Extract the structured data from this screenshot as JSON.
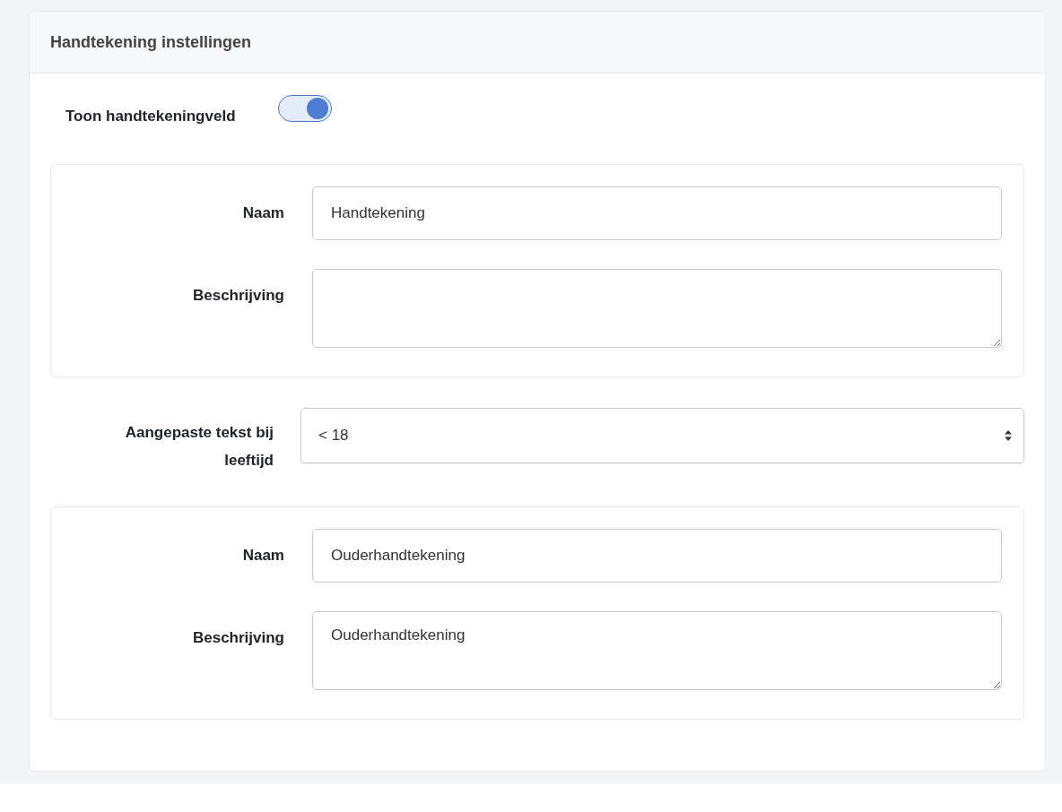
{
  "header": {
    "title": "Handtekening instellingen"
  },
  "toggle": {
    "label": "Toon handtekeningveld",
    "on": true
  },
  "signature": {
    "fields": [
      {
        "label": "Naam",
        "kind": "input",
        "value": "Handtekening"
      },
      {
        "label": "Beschrijving",
        "kind": "textarea"
      }
    ]
  },
  "age_select": {
    "label": "Aangepaste tekst bij leeftijd",
    "value": "< 18"
  },
  "age_signature": {
    "fields": [
      {
        "label": "Naam",
        "kind": "input",
        "value": "Ouderhandtekening"
      },
      {
        "label": "Beschrijving",
        "kind": "textarea",
        "value": "Ouderhandtekening"
      }
    ]
  }
}
